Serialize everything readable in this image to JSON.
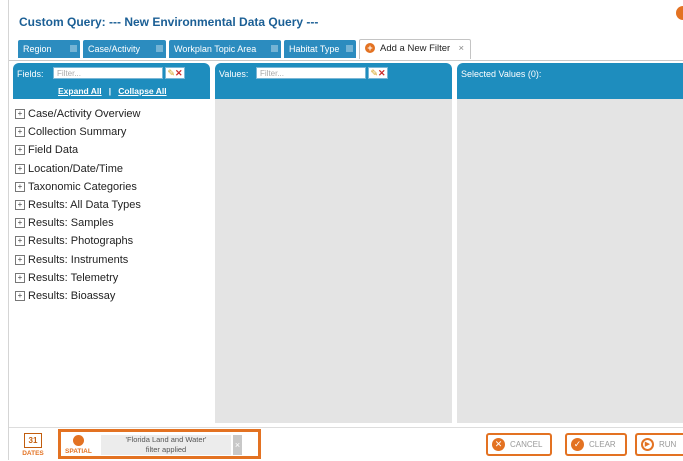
{
  "window": {
    "title": "Custom Query: --- New Environmental Data Query ---"
  },
  "tabs": [
    {
      "label": "Region"
    },
    {
      "label": "Case/Activity"
    },
    {
      "label": "Workplan Topic Area"
    },
    {
      "label": "Habitat Type"
    },
    {
      "label": "Add a New Filter",
      "active": true
    }
  ],
  "panels": {
    "fields": {
      "label": "Fields:",
      "placeholder": "Filter...",
      "expand_all": "Expand All",
      "separator": "|",
      "collapse_all": "Collapse All"
    },
    "values": {
      "label": "Values:",
      "placeholder": "Filter..."
    },
    "selected": {
      "label": "Selected Values (0):"
    }
  },
  "tree_items": [
    "Case/Activity Overview",
    "Collection Summary",
    "Field Data",
    "Location/Date/Time",
    "Taxonomic Categories",
    "Results: All Data Types",
    "Results: Samples",
    "Results: Photographs",
    "Results: Instruments",
    "Results: Telemetry",
    "Results: Bioassay"
  ],
  "bottom": {
    "dates_label": "DATES",
    "calendar_day": "31",
    "spatial_label": "SPATIAL",
    "spatial_filter_name": "'Florida Land and Water'",
    "spatial_filter_status": "filter applied",
    "cancel_label": "CANCEL",
    "clear_label": "CLEAR",
    "run_label": "RUN"
  },
  "colors": {
    "accent": "#e37222",
    "header_blue": "#1e8dbe",
    "title_blue": "#1b5f95",
    "panel_grey": "#e4e4e4"
  },
  "icons": {
    "tab_close": "close-icon",
    "add_filter": "plus-circle-icon",
    "pencil": "pencil-icon",
    "clear_filter": "x-icon",
    "tree_expand": "plus-box-icon",
    "calendar": "calendar-icon",
    "globe": "globe-icon",
    "cancel": "cancel-icon",
    "clear": "check-icon",
    "run": "run-icon"
  }
}
